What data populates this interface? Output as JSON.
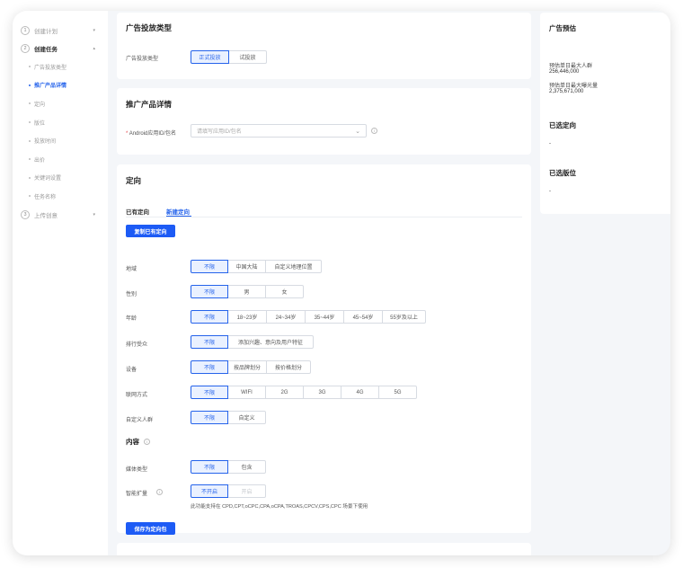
{
  "sidebar": {
    "steps": [
      {
        "num": "1",
        "label": "创建计划",
        "chev": "▾"
      },
      {
        "num": "2",
        "label": "创建任务",
        "chev": "▴"
      },
      {
        "num": "3",
        "label": "上传创意",
        "chev": "▾"
      }
    ],
    "subitems": [
      "广告投放类型",
      "推广产品详情",
      "定向",
      "版位",
      "投放时间",
      "出价",
      "关键词设置",
      "任务名称"
    ]
  },
  "ad_type": {
    "title": "广告投放类型",
    "label": "广告投放类型",
    "options": [
      "正式投放",
      "试投放"
    ]
  },
  "product": {
    "title": "推广产品详情",
    "required_mark": "*",
    "label": "Android应用ID/包名",
    "placeholder": "请填写应用ID/包名",
    "chevron": "⌄"
  },
  "targeting": {
    "title": "定向",
    "tabs": [
      "已有定向",
      "新建定向"
    ],
    "copy_button": "复制已有定向",
    "rows": [
      {
        "label": "地域",
        "options": [
          "不限",
          "中国大陆",
          "自定义地理位置"
        ]
      },
      {
        "label": "性别",
        "options": [
          "不限",
          "男",
          "女"
        ]
      },
      {
        "label": "年龄",
        "options": [
          "不限",
          "18~23岁",
          "24~34岁",
          "35~44岁",
          "45~54岁",
          "55岁及以上"
        ]
      },
      {
        "label": "排行受众",
        "options": [
          "不限",
          "添加兴趣、意向及用户特征"
        ]
      },
      {
        "label": "设备",
        "options": [
          "不限",
          "按品牌划分",
          "按价格划分"
        ]
      },
      {
        "label": "联网方式",
        "options": [
          "不限",
          "WIFI",
          "2G",
          "3G",
          "4G",
          "5G"
        ]
      },
      {
        "label": "自定义人群",
        "options": [
          "不限",
          "自定义"
        ]
      }
    ],
    "content": {
      "title": "内容",
      "media_label": "媒体类型",
      "media_options": [
        "不限",
        "包含"
      ],
      "smart_label": "智能扩量",
      "smart_options": [
        "不开启",
        "开启"
      ],
      "note": "此功能支持在 CPD,CPT,oCPC,CPA,oCPA,TROAS,CPCV,CPS,CPC 场景下使用"
    },
    "save_button": "保存为定向包"
  },
  "estimate": {
    "title": "广告预估",
    "daily_reach_label": "预估单日最大人群",
    "daily_reach_value": "256,446,000",
    "daily_impr_label": "预估单日最大曝光量",
    "daily_impr_value": "2,375,671,000",
    "selected_targeting_title": "已选定向",
    "selected_targeting_value": "-",
    "selected_position_title": "已选版位",
    "selected_position_value": "-"
  },
  "icons": {
    "info": "i"
  }
}
